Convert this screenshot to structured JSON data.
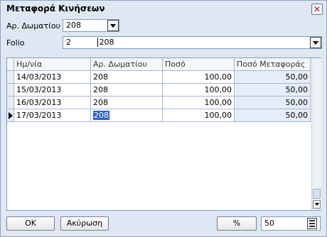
{
  "window": {
    "title": "Μεταφορά Κινήσεων",
    "close_icon": "close-icon",
    "close_glyph": "✕"
  },
  "form": {
    "room_label": "Αρ. Δωματίου",
    "room_value": "208",
    "folio_label": "Folio",
    "folio_number": "2",
    "folio_room": "208"
  },
  "grid": {
    "columns": [
      "Ημ/νία",
      "Αρ. Δωματίου",
      "Ποσό",
      "Ποσό Μεταφοράς"
    ],
    "rows": [
      {
        "date": "14/03/2013",
        "room": "208",
        "amount": "100,00",
        "transfer": "50,00"
      },
      {
        "date": "15/03/2013",
        "room": "208",
        "amount": "100,00",
        "transfer": "50,00"
      },
      {
        "date": "16/03/2013",
        "room": "208",
        "amount": "100,00",
        "transfer": "50,00"
      },
      {
        "date": "17/03/2013",
        "room": "208",
        "amount": "100,00",
        "transfer": "50,00"
      }
    ]
  },
  "footer": {
    "ok_label": "OK",
    "cancel_label": "Ακύρωση",
    "percent_label": "%",
    "percent_value": "50"
  }
}
